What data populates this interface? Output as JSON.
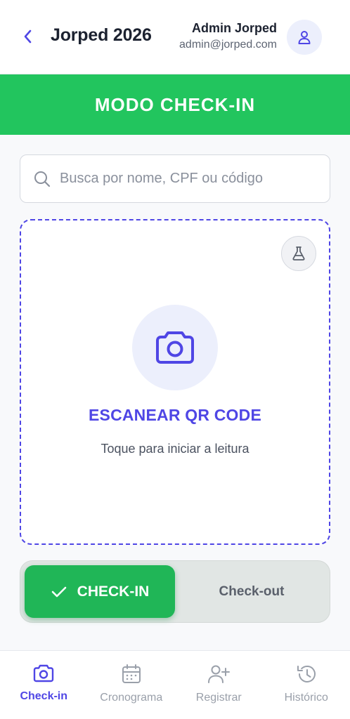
{
  "header": {
    "event_title": "Jorped 2026",
    "user_name": "Admin Jorped",
    "user_email": "admin@jorped.com",
    "back_icon": "chevron-left-icon",
    "avatar_icon": "user-icon"
  },
  "mode_banner": {
    "label": "MODO CHECK-IN",
    "color": "#22c55e"
  },
  "search": {
    "placeholder": "Busca por nome, CPF ou código",
    "value": ""
  },
  "scanner": {
    "title": "ESCANEAR QR CODE",
    "subtitle": "Toque para iniciar a leitura",
    "icon": "camera-icon",
    "test_icon": "flask-icon",
    "accent": "#4f46e5"
  },
  "mode_toggle": {
    "checkin_label": "CHECK-IN",
    "checkout_label": "Check-out",
    "selected": "CHECK-IN"
  },
  "bottom_nav": {
    "items": [
      {
        "label": "Check-in",
        "icon": "camera-icon",
        "active": true
      },
      {
        "label": "Cronograma",
        "icon": "calendar-icon",
        "active": false
      },
      {
        "label": "Registrar",
        "icon": "user-plus-icon",
        "active": false
      },
      {
        "label": "Histórico",
        "icon": "history-icon",
        "active": false
      }
    ]
  }
}
